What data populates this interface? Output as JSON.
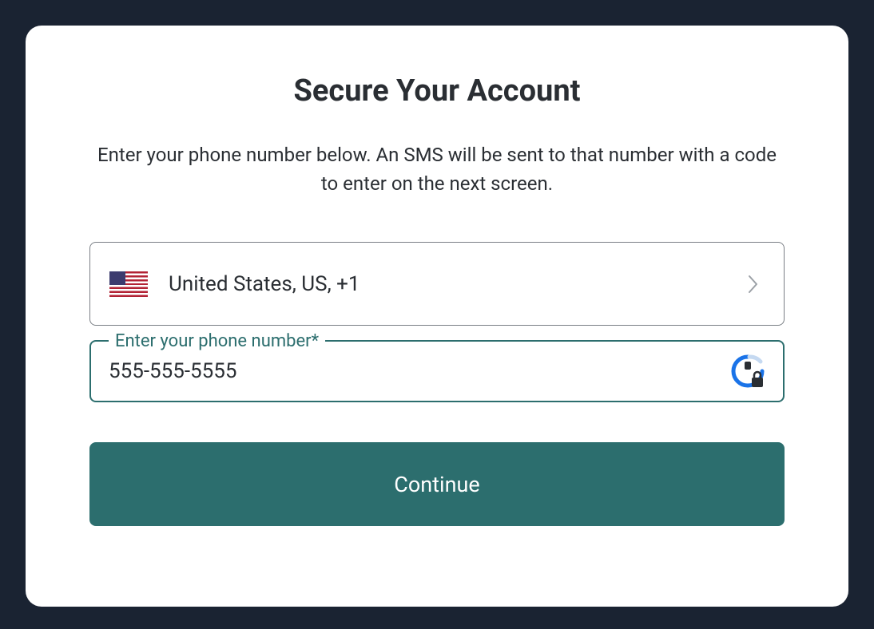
{
  "title": "Secure Your Account",
  "description": "Enter your phone number below. An SMS will be sent to that number with a code to enter on the next screen.",
  "country": {
    "label": "United States, US, +1"
  },
  "phone": {
    "legend": "Enter your phone number*",
    "value": "555-555-5555"
  },
  "continue_label": "Continue",
  "colors": {
    "background": "#1a2332",
    "card": "#ffffff",
    "accent": "#2c6e6e",
    "text": "#2a2e33",
    "border": "#7a7f85"
  }
}
